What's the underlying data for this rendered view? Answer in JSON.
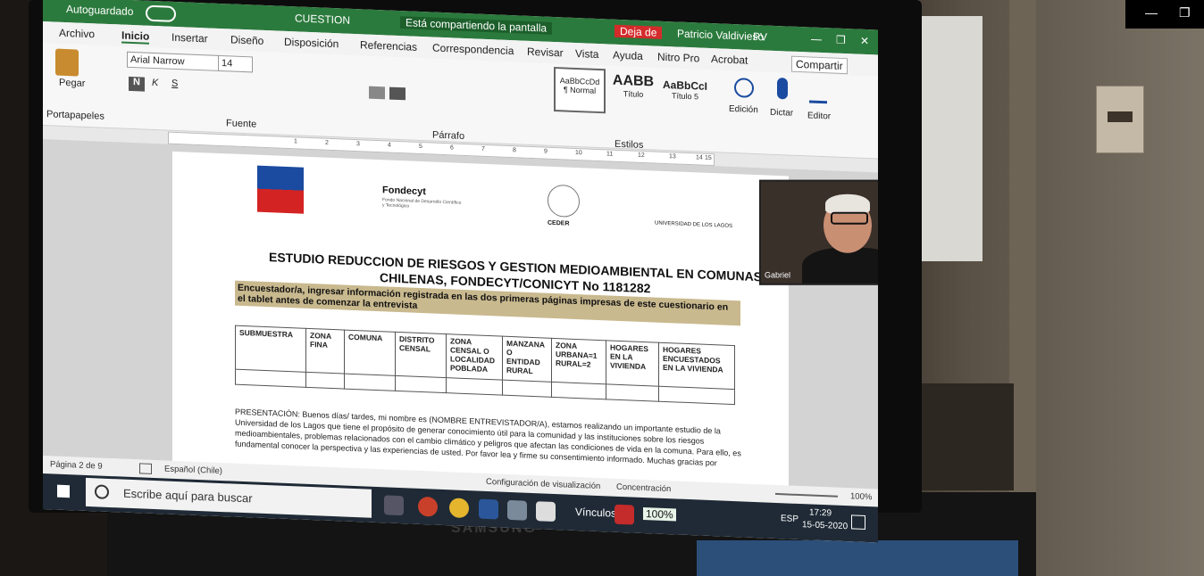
{
  "window_controls": {
    "minimize": "—",
    "restore": "❐"
  },
  "titlebar": {
    "autosave": "Autoguardado",
    "doc_title": "CUESTION",
    "sharing": "Está compartiendo la pantalla",
    "stop_share": "Deja de",
    "user": "Patricio Valdivieso",
    "user_initials": "PV"
  },
  "tabs": [
    "Archivo",
    "Inicio",
    "Insertar",
    "Diseño",
    "Disposición",
    "Referencias",
    "Correspondencia",
    "Revisar",
    "Vista",
    "Ayuda",
    "Nitro Pro",
    "Acrobat"
  ],
  "share_button": "Compartir",
  "ribbon": {
    "paste": "Pegar",
    "clipboard": "Portapapeles",
    "font_name": "Arial Narrow",
    "font_size": "14",
    "font_group": "Fuente",
    "paragraph_group": "Párrafo",
    "styles": [
      {
        "sample": "AaBbCcDd",
        "name": "¶ Normal"
      },
      {
        "sample": "AABB",
        "name": "Título"
      },
      {
        "sample": "AaBbCcI",
        "name": "Título 5"
      }
    ],
    "styles_group": "Estilos",
    "edit": "Edición",
    "dictate": "Dictar",
    "editor": "Editor"
  },
  "ruler_marks": [
    "1",
    "2",
    "3",
    "4",
    "5",
    "6",
    "7",
    "8",
    "9",
    "10",
    "11",
    "12",
    "13",
    "14",
    "15"
  ],
  "document": {
    "logo_fondecyt": "Fondecyt",
    "fondecyt_sub": "Fondo Nacional de Desarrollo Científico y Tecnológico",
    "logo_ceder": "CEDER",
    "logo_ulagos": "UNIVERSIDAD DE LOS LAGOS",
    "title_line1": "ESTUDIO REDUCCION DE RIESGOS Y GESTION MEDIOAMBIENTAL EN COMUNAS",
    "title_line2": "CHILENAS, FONDECYT/CONICYT No 1181282",
    "instruction": "Encuestador/a, ingresar información registrada en las dos primeras páginas impresas de este cuestionario en el tablet antes de comenzar la entrevista",
    "table_headers": [
      "SUBMUESTRA",
      "ZONA FINA",
      "COMUNA",
      "DISTRITO CENSAL",
      "ZONA CENSAL O LOCALIDAD POBLADA",
      "MANZANA O ENTIDAD RURAL",
      "ZONA URBANA=1 RURAL=2",
      "HOGARES EN LA VIVIENDA",
      "HOGARES ENCUESTADOS EN LA VIVIENDA"
    ],
    "presentation": "PRESENTACIÓN: Buenos días/ tardes, mi nombre es (NOMBRE ENTREVISTADOR/A), estamos realizando un importante estudio de la Universidad de los Lagos que tiene el propósito de generar conocimiento útil para la comunidad y las instituciones sobre los riesgos medioambientales, problemas relacionados con el cambio climático y peligros que afectan las condiciones de vida en la comuna. Para ello, es fundamental conocer la perspectiva y las experiencias de usted. Por favor lea y firme su consentimiento informado. Muchas gracias por"
  },
  "webcam": {
    "name": "Gabriel"
  },
  "statusbar": {
    "page": "Página 2 de 9",
    "language": "Español (Chile)",
    "display": "Configuración de visualización",
    "focus": "Concentración",
    "zoom": "100%"
  },
  "taskbar": {
    "search_placeholder": "Escribe aquí para buscar",
    "links": "Vínculos",
    "battery": "100%",
    "lang": "ESP",
    "time": "17:29",
    "date": "15-05-2020"
  },
  "monitor_brand": "SAMSUNG"
}
